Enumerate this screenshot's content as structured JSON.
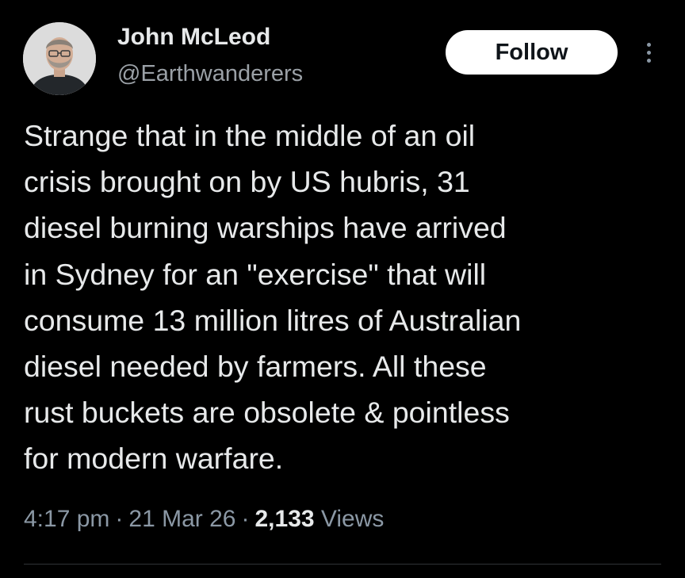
{
  "author": {
    "display_name": "John McLeod",
    "handle": "@Earthwanderers",
    "avatar_icon": "user-avatar-photo"
  },
  "actions": {
    "follow_label": "Follow",
    "more_icon": "more-options-icon"
  },
  "tweet": {
    "lines": [
      "Strange that in the middle of an oil",
      "crisis brought on by US hubris, 31",
      "diesel burning warships have arrived",
      "in Sydney for an \"exercise\" that will",
      "consume 13 million litres of Australian",
      "diesel needed by farmers. All these",
      "rust buckets are obsolete & pointless",
      "for modern warfare."
    ]
  },
  "meta": {
    "time": "4:17 pm",
    "separator": "·",
    "date": "21 Mar 26",
    "views_count": "2,133",
    "views_label": "Views"
  },
  "colors": {
    "background": "#000000",
    "primary_text": "#e7e9ea",
    "secondary_text": "#8b98a5",
    "button_bg": "#ffffff",
    "button_text": "#0f1419"
  }
}
